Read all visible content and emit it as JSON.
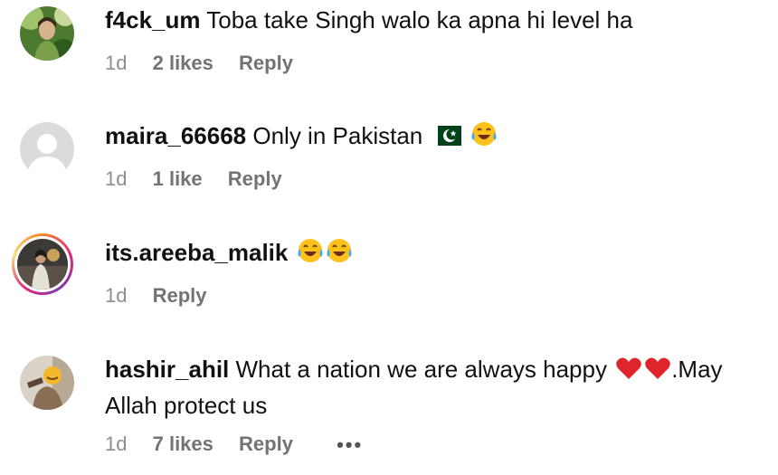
{
  "comments": [
    {
      "username": "f4ck_um",
      "text": "Toba take Singh walo ka apna hi level ha",
      "time": "1d",
      "likes": "2 likes",
      "reply": "Reply"
    },
    {
      "username": "maira_66668",
      "text": "Only in Pakistan",
      "time": "1d",
      "likes": "1 like",
      "reply": "Reply",
      "emojis": [
        "pakistan-flag",
        "tears-of-joy"
      ]
    },
    {
      "username": "its.areeba_malik",
      "text": "",
      "time": "1d",
      "reply": "Reply",
      "emojis": [
        "tears-of-joy",
        "tears-of-joy"
      ]
    },
    {
      "username": "hashir_ahil",
      "text_before": "What a nation we are always happy",
      "text_after": ".May Allah protect us",
      "time": "1d",
      "likes": "7 likes",
      "reply": "Reply",
      "emojis": [
        "red-heart",
        "red-heart"
      ],
      "more": "•••"
    }
  ],
  "colors": {
    "text": "#111111",
    "meta": "#737373",
    "story_ring_start": "#f58529",
    "story_ring_end": "#8134af"
  }
}
